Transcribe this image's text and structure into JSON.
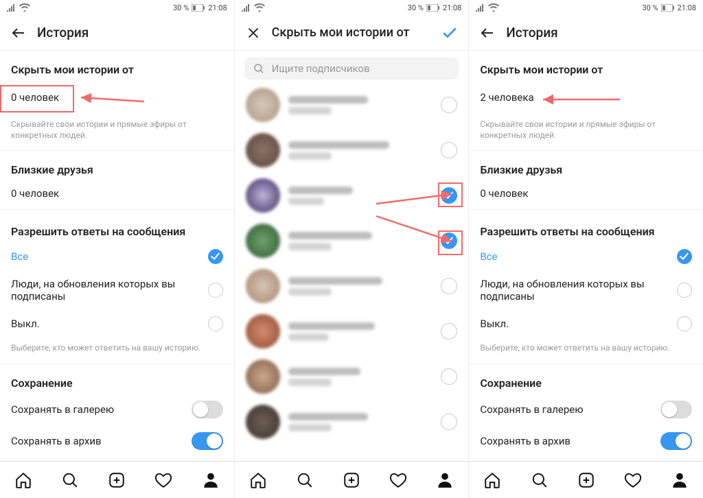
{
  "status": {
    "percent": "30 %",
    "time": "21:08"
  },
  "panelA": {
    "title": "История",
    "hideSection": "Скрыть мои истории от",
    "hideValue": "0 человек",
    "hideHint": "Скрывайте свои истории и прямые эфиры от конкретных людей.",
    "closeSection": "Близкие друзья",
    "closeValue": "0 человек",
    "replySection": "Разрешить ответы на сообщения",
    "replyAll": "Все",
    "replyFollowed": "Люди, на обновления которых вы подписаны",
    "replyOff": "Выкл.",
    "replyHint": "Выберите, кто может ответить на вашу историю.",
    "saveSection": "Сохранение",
    "saveGallery": "Сохранять в галерею",
    "saveArchive": "Сохранять в архив"
  },
  "panelB": {
    "title": "Скрыть мои истории от",
    "searchPlaceholder": "Ищите подписчиков"
  },
  "panelC": {
    "title": "История",
    "hideSection": "Скрыть мои истории от",
    "hideValue": "2 человека",
    "hideHint": "Скрывайте свои истории и прямые эфиры от конкретных людей.",
    "closeSection": "Близкие друзья",
    "closeValue": "0 человек",
    "replySection": "Разрешить ответы на сообщения",
    "replyAll": "Все",
    "replyFollowed": "Люди, на обновления которых вы подписаны",
    "replyOff": "Выкл.",
    "replyHint": "Выберите, кто может ответить на вашу историю.",
    "saveSection": "Сохранение",
    "saveGallery": "Сохранять в галерею",
    "saveArchive": "Сохранять в архив"
  }
}
